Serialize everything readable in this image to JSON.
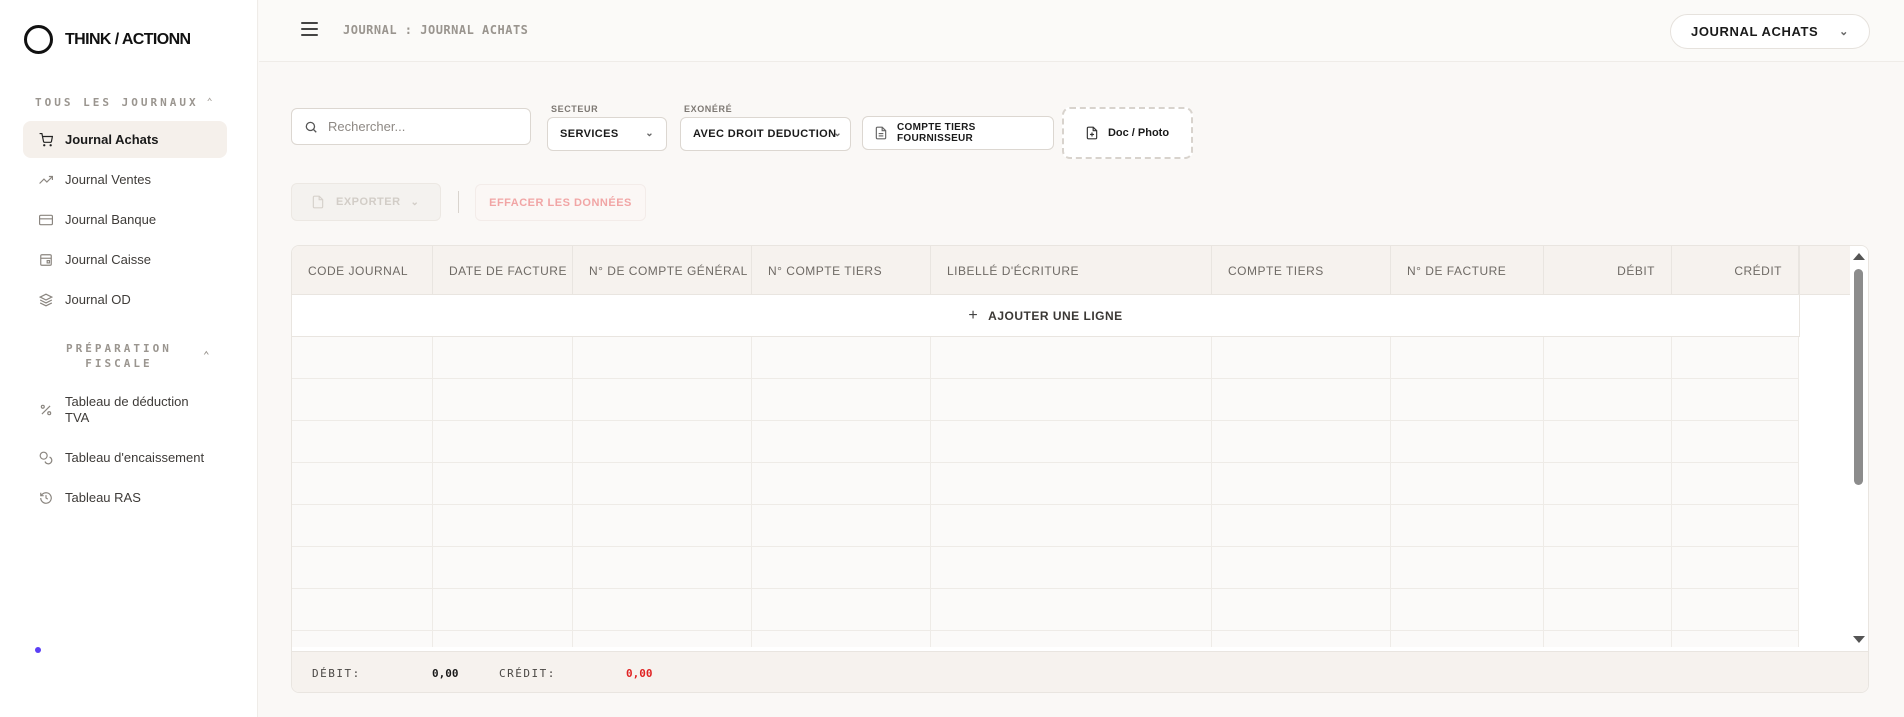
{
  "brand": {
    "name": "THINK / ACTIONN"
  },
  "sidebar": {
    "section1_title": "TOUS LES JOURNAUX",
    "journals": [
      {
        "label": "Journal Achats",
        "icon": "cart-icon",
        "active": true
      },
      {
        "label": "Journal Ventes",
        "icon": "trending-up-icon",
        "active": false
      },
      {
        "label": "Journal Banque",
        "icon": "credit-card-icon",
        "active": false
      },
      {
        "label": "Journal Caisse",
        "icon": "cash-register-icon",
        "active": false
      },
      {
        "label": "Journal OD",
        "icon": "layers-icon",
        "active": false
      }
    ],
    "section2_title_line1": "PRÉPARATION",
    "section2_title_line2": "FISCALE",
    "fiscal": [
      {
        "label": "Tableau de déduction TVA",
        "icon": "percent-icon"
      },
      {
        "label": "Tableau d'encaissement",
        "icon": "coins-icon"
      },
      {
        "label": "Tableau RAS",
        "icon": "history-icon"
      }
    ]
  },
  "topbar": {
    "breadcrumb": "JOURNAL : JOURNAL ACHATS",
    "journal_select": "JOURNAL ACHATS"
  },
  "filters": {
    "search_placeholder": "Rechercher...",
    "secteur_label": "SECTEUR",
    "secteur_value": "SERVICES",
    "exonere_label": "EXONÉRÉ",
    "exonere_value": "AVEC DROIT DEDUCTION",
    "compte_tiers_button": "COMPTE TIERS FOURNISSEUR",
    "doc_photo_button": "Doc / Photo"
  },
  "actions": {
    "export_label": "EXPORTER",
    "clear_label": "EFFACER LES DONNÉES"
  },
  "table": {
    "columns": [
      "CODE JOURNAL",
      "DATE DE FACTURE",
      "N° DE COMPTE GÉNÉRAL",
      "N° COMPTE TIERS",
      "LIBELLÉ D'ÉCRITURE",
      "COMPTE TIERS",
      "N° DE FACTURE",
      "DÉBIT",
      "CRÉDIT"
    ],
    "add_row_label": "AJOUTER UNE LIGNE"
  },
  "totals": {
    "debit_label": "DÉBIT:",
    "debit_value": "0,00",
    "credit_label": "CRÉDIT:",
    "credit_value": "0,00"
  },
  "colors": {
    "accent_dot": "#5b3ff5",
    "credit_red": "#e02424",
    "danger_light": "#f1a5a5"
  }
}
